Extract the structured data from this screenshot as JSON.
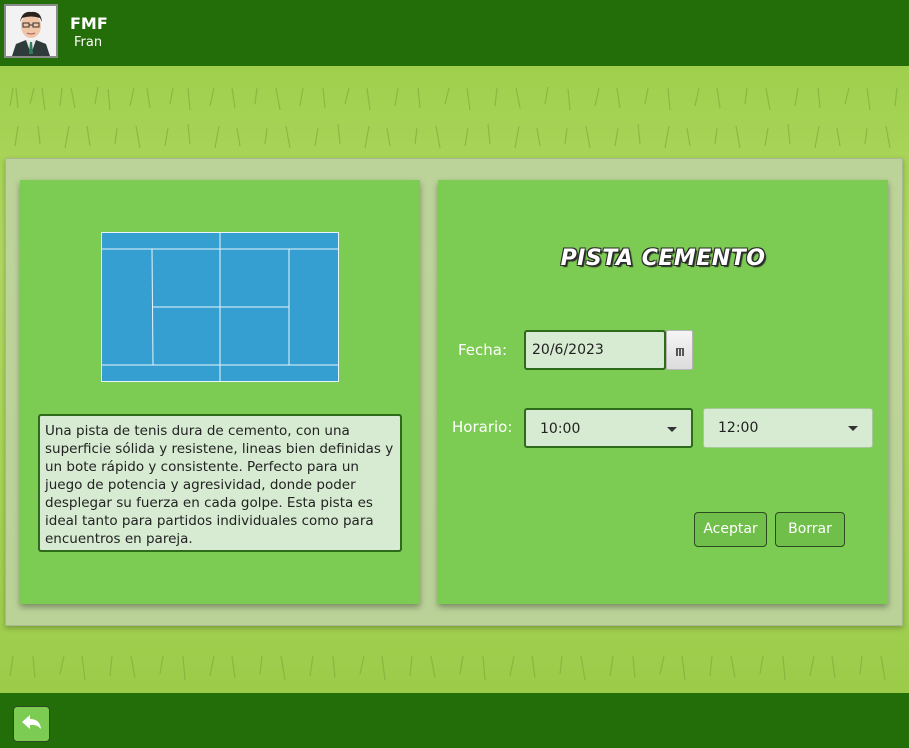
{
  "header": {
    "app_title": "FMF",
    "user_name": "Fran"
  },
  "court": {
    "title": "PISTA CEMENTO",
    "description": "Una pista de tenis dura de cemento, con una superficie sólida y resistene, lineas bien definidas y un bote rápido y consistente. Perfecto para un juego de potencia y agresividad, donde poder desplegar su fuerza en cada golpe. Esta pista es ideal tanto para partidos individuales como para encuentros en pareja."
  },
  "form": {
    "date_label": "Fecha:",
    "date_value": "20/6/2023",
    "time_label": "Horario:",
    "start_time": "10:00",
    "end_time": "12:00"
  },
  "actions": {
    "accept_label": "Aceptar",
    "clear_label": "Borrar"
  },
  "colors": {
    "header_bg": "#236e08",
    "panel_bg": "#7ccb52",
    "court_blue": "#369fd1"
  },
  "icons": {
    "calendar": "calendar-icon",
    "back": "back-arrow-icon"
  }
}
